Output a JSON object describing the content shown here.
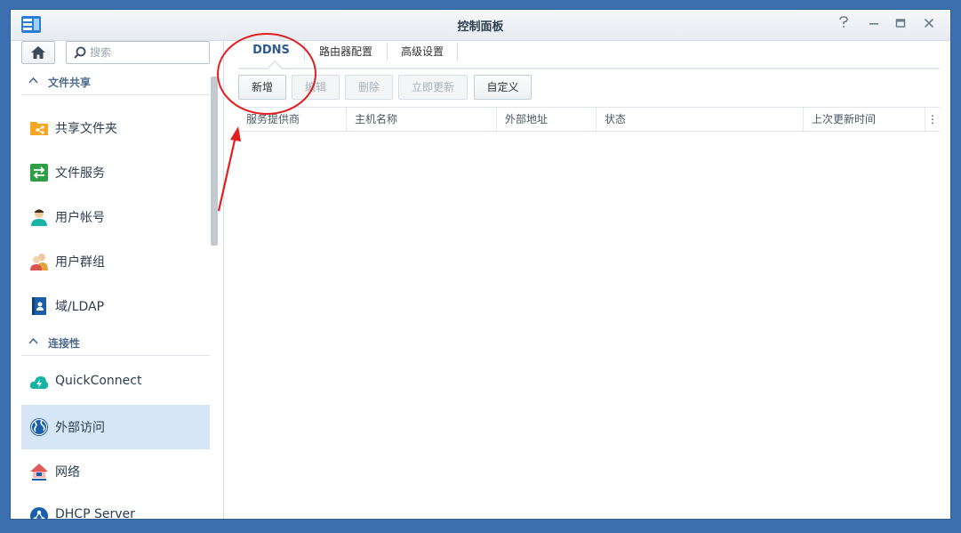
{
  "window": {
    "title": "控制面板",
    "controls": [
      "help-icon",
      "minimize-icon",
      "maximize-icon",
      "close-icon"
    ]
  },
  "sidebar": {
    "search_placeholder": "搜索",
    "sections": [
      {
        "title": "文件共享",
        "items": [
          {
            "label": "共享文件夹",
            "icon": "shared-folder-icon"
          },
          {
            "label": "文件服务",
            "icon": "file-services-icon"
          },
          {
            "label": "用户帐号",
            "icon": "user-icon"
          },
          {
            "label": "用户群组",
            "icon": "group-icon"
          },
          {
            "label": "域/LDAP",
            "icon": "domain-ldap-icon"
          }
        ]
      },
      {
        "title": "连接性",
        "items": [
          {
            "label": "QuickConnect",
            "icon": "quickconnect-icon"
          },
          {
            "label": "外部访问",
            "icon": "external-access-icon",
            "active": true
          },
          {
            "label": "网络",
            "icon": "network-icon"
          },
          {
            "label": "DHCP Server",
            "icon": "dhcp-server-icon"
          }
        ]
      }
    ]
  },
  "main": {
    "tabs": [
      {
        "label": "DDNS",
        "active": true
      },
      {
        "label": "路由器配置"
      },
      {
        "label": "高级设置"
      }
    ],
    "toolbar": [
      {
        "label": "新增",
        "enabled": true
      },
      {
        "label": "编辑",
        "enabled": false
      },
      {
        "label": "删除",
        "enabled": false
      },
      {
        "label": "立即更新",
        "enabled": false
      },
      {
        "label": "自定义",
        "enabled": true
      }
    ],
    "columns": [
      "服务提供商",
      "主机名称",
      "外部地址",
      "状态",
      "上次更新时间"
    ],
    "rows": []
  },
  "colors": {
    "desktop": "#3b6fb0",
    "accent": "#2d5a93",
    "active_item": "#d6e6f7",
    "annotation": "#e02020"
  }
}
